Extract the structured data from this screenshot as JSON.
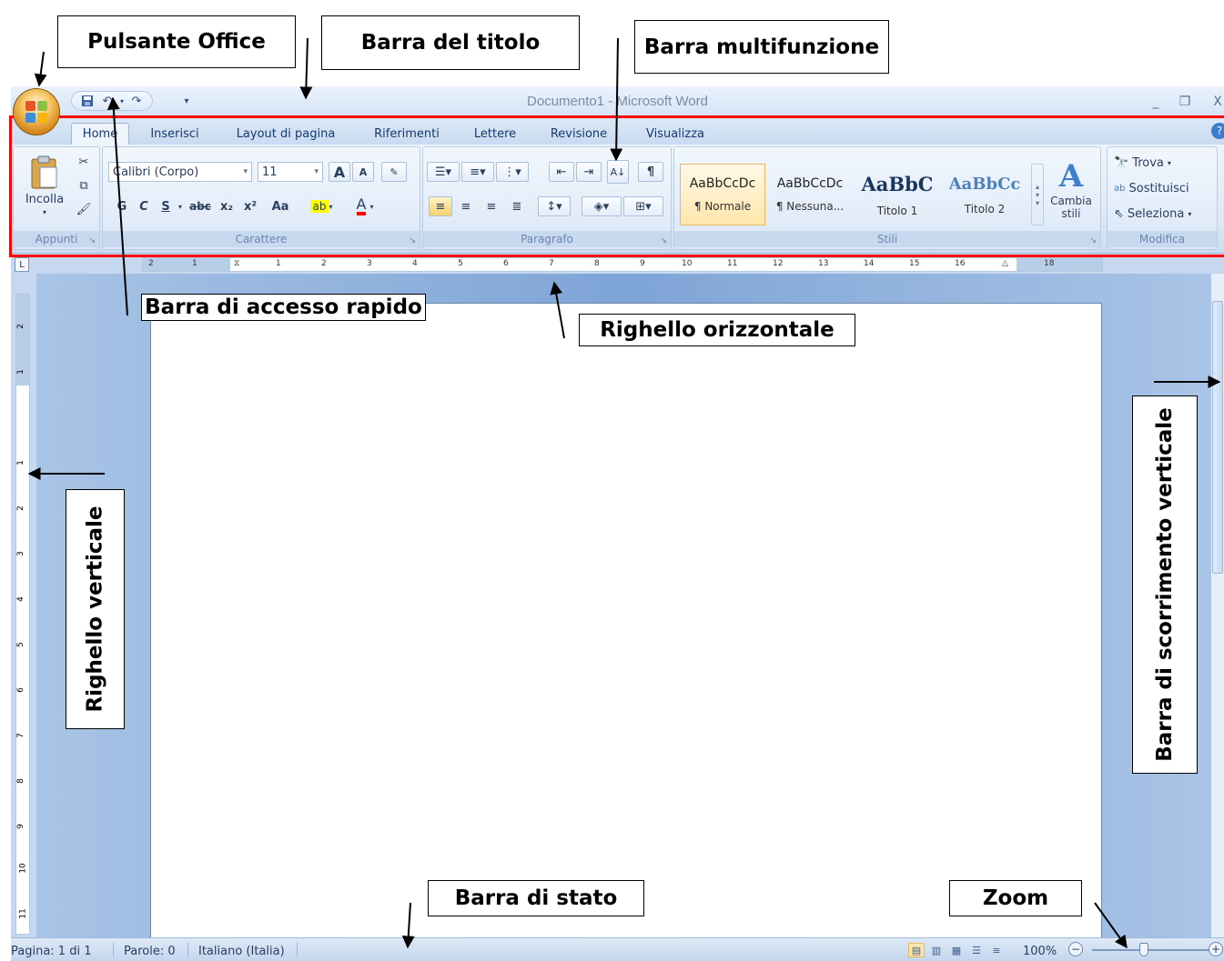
{
  "window": {
    "title": "Documento1 - Microsoft Word",
    "controls": {
      "minimize": "_",
      "restore": "❐",
      "close": "X"
    }
  },
  "quick_access": [
    "save-icon",
    "undo-icon",
    "redo-icon",
    "customize-icon"
  ],
  "tabs": [
    {
      "label": "Home",
      "active": true
    },
    {
      "label": "Inserisci"
    },
    {
      "label": "Layout di pagina"
    },
    {
      "label": "Riferimenti"
    },
    {
      "label": "Lettere"
    },
    {
      "label": "Revisione"
    },
    {
      "label": "Visualizza"
    }
  ],
  "ribbon": {
    "clipboard": {
      "paste_label": "Incolla",
      "group_label": "Appunti"
    },
    "font": {
      "font_name": "Calibri (Corpo)",
      "font_size": "11",
      "bold": "G",
      "italic": "C",
      "underline": "S",
      "strike": "abc",
      "subscript": "x₂",
      "superscript": "x²",
      "change_case": "Aa",
      "grow": "A",
      "shrink": "A",
      "group_label": "Carattere"
    },
    "paragraph": {
      "group_label": "Paragrafo",
      "pilcrow": "¶"
    },
    "styles": {
      "items": [
        {
          "sample": "AaBbCcDc",
          "name": "¶ Normale",
          "selected": true
        },
        {
          "sample": "AaBbCcDc",
          "name": "¶ Nessuna..."
        },
        {
          "sample": "AaBbC",
          "name": "Titolo 1"
        },
        {
          "sample": "AaBbCc",
          "name": "Titolo 2"
        }
      ],
      "change_styles_label": "Cambia stili",
      "group_label": "Stili"
    },
    "editing": {
      "find": "Trova",
      "replace": "Sostituisci",
      "select": "Seleziona",
      "group_label": "Modifica"
    }
  },
  "status_bar": {
    "page": "Pagina: 1 di 1",
    "words": "Parole: 0",
    "language": "Italiano (Italia)",
    "zoom": "100%",
    "zoom_level_percent": 100
  },
  "annotations": {
    "office_button": "Pulsante Office",
    "title_bar": "Barra del titolo",
    "ribbon": "Barra multifunzione",
    "quick_access": "Barra di accesso rapido",
    "horizontal_ruler": "Righello orizzontale",
    "vertical_ruler": "Righello verticale",
    "vertical_scrollbar": "Barra di scorrimento verticale",
    "status_bar": "Barra di stato",
    "zoom": "Zoom"
  },
  "colors": {
    "highlight_outline": "#ff0000",
    "window_background": "#c5d8ef",
    "page": "#ffffff"
  }
}
